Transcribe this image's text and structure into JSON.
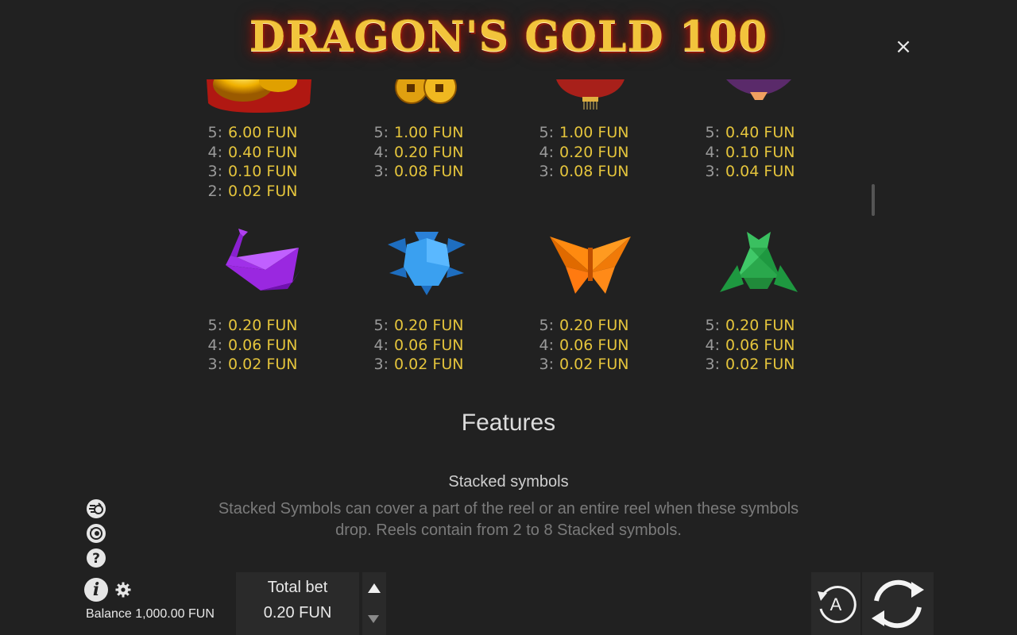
{
  "header": {
    "logo_text": "DRAGON'S GOLD 100",
    "close_icon": "×"
  },
  "paytable": {
    "top_row": [
      {
        "symbol": "gold-ingot",
        "pays": [
          {
            "k": "5:",
            "v": "6.00 FUN"
          },
          {
            "k": "4:",
            "v": "0.40 FUN"
          },
          {
            "k": "3:",
            "v": "0.10 FUN"
          },
          {
            "k": "2:",
            "v": "0.02 FUN"
          }
        ]
      },
      {
        "symbol": "gold-coins",
        "pays": [
          {
            "k": "5:",
            "v": "1.00 FUN"
          },
          {
            "k": "4:",
            "v": "0.20 FUN"
          },
          {
            "k": "3:",
            "v": "0.08 FUN"
          }
        ]
      },
      {
        "symbol": "red-lantern",
        "pays": [
          {
            "k": "5:",
            "v": "1.00 FUN"
          },
          {
            "k": "4:",
            "v": "0.20 FUN"
          },
          {
            "k": "3:",
            "v": "0.08 FUN"
          }
        ]
      },
      {
        "symbol": "purple-lantern",
        "pays": [
          {
            "k": "5:",
            "v": "0.40 FUN"
          },
          {
            "k": "4:",
            "v": "0.10 FUN"
          },
          {
            "k": "3:",
            "v": "0.04 FUN"
          }
        ]
      }
    ],
    "bottom_row": [
      {
        "symbol": "origami-swan",
        "pays": [
          {
            "k": "5:",
            "v": "0.20 FUN"
          },
          {
            "k": "4:",
            "v": "0.06 FUN"
          },
          {
            "k": "3:",
            "v": "0.02 FUN"
          }
        ]
      },
      {
        "symbol": "origami-turtle",
        "pays": [
          {
            "k": "5:",
            "v": "0.20 FUN"
          },
          {
            "k": "4:",
            "v": "0.06 FUN"
          },
          {
            "k": "3:",
            "v": "0.02 FUN"
          }
        ]
      },
      {
        "symbol": "origami-butterfly",
        "pays": [
          {
            "k": "5:",
            "v": "0.20 FUN"
          },
          {
            "k": "4:",
            "v": "0.06 FUN"
          },
          {
            "k": "3:",
            "v": "0.02 FUN"
          }
        ]
      },
      {
        "symbol": "origami-frog",
        "pays": [
          {
            "k": "5:",
            "v": "0.20 FUN"
          },
          {
            "k": "4:",
            "v": "0.06 FUN"
          },
          {
            "k": "3:",
            "v": "0.02 FUN"
          }
        ]
      }
    ]
  },
  "features": {
    "title": "Features",
    "subtitle": "Stacked symbols",
    "description": "Stacked Symbols can cover a part of the reel or an entire reel when these symbols drop. Reels contain from 2 to 8 Stacked symbols."
  },
  "controls": {
    "info_label": "i",
    "balance": "Balance 1,000.00 FUN",
    "total_bet_label": "Total bet",
    "total_bet_value": "0.20 FUN",
    "autoplay_label": "A"
  },
  "colors": {
    "background": "#212121",
    "pay_value": "#e4c43c",
    "pay_key": "#9a9a9a",
    "logo_gold": "#f2c43c"
  }
}
